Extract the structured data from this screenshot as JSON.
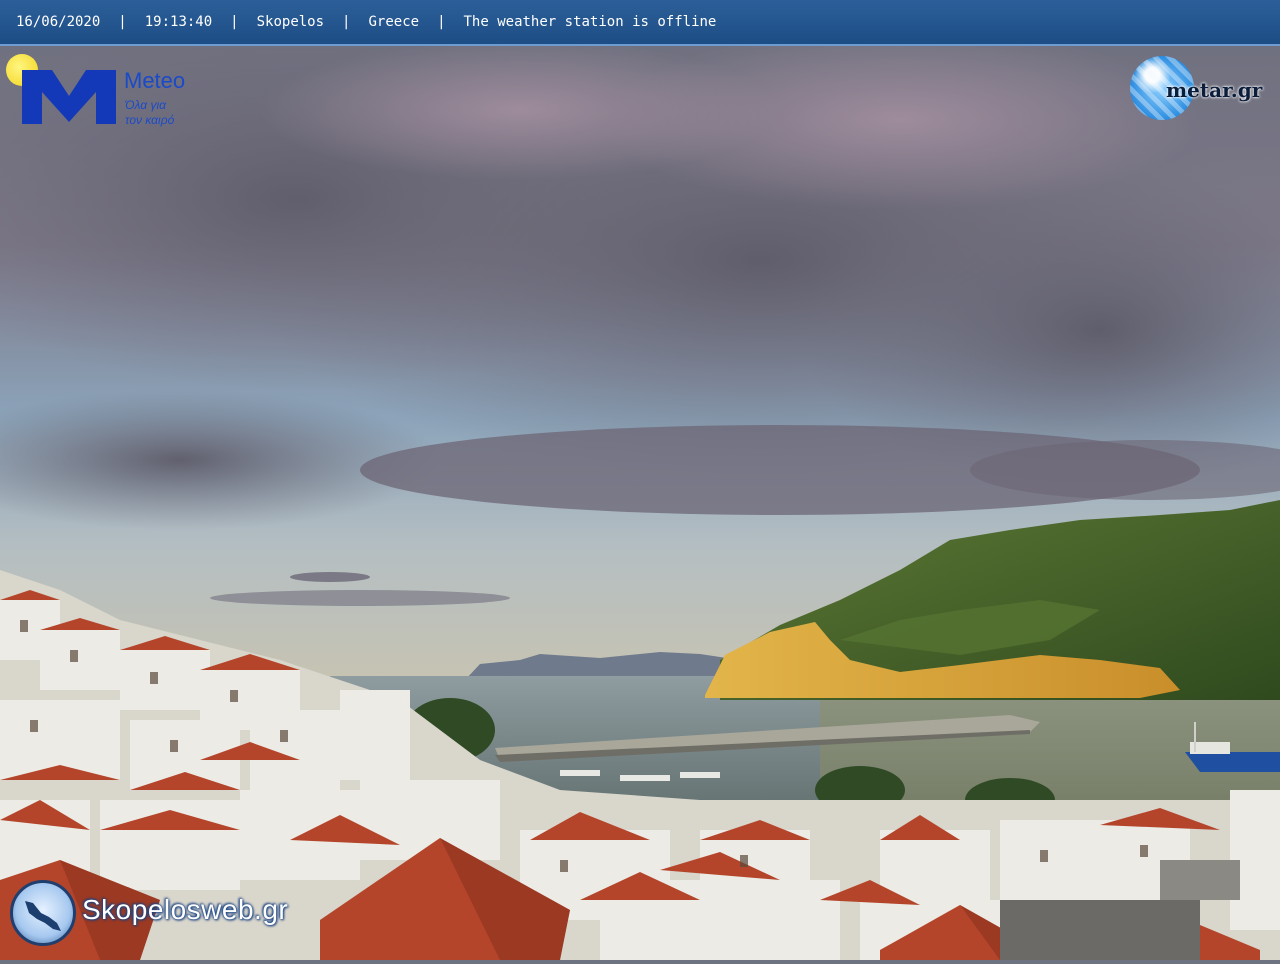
{
  "header": {
    "date": "16/06/2020",
    "time": "19:13:40",
    "location": "Skopelos",
    "country": "Greece",
    "status": "The weather station is offline",
    "separator": "|"
  },
  "logos": {
    "meteo": {
      "name": "Meteo",
      "tagline_line1": "Όλα για",
      "tagline_line2": "τον καιρό",
      "brand_color": "#1439b8"
    },
    "metar": {
      "text": "metar.gr"
    },
    "skopelosweb": {
      "text": "Skopelosweb.gr"
    }
  },
  "scene": {
    "description_icon": "harbor-town-sunset",
    "colors": {
      "sky": "#8ea4bb",
      "clouds": "#6b6672",
      "sea": "#7d8d8f",
      "hill": "#4c6a2a",
      "roofs": "#b5472c",
      "walls": "#e8e6e0"
    }
  }
}
